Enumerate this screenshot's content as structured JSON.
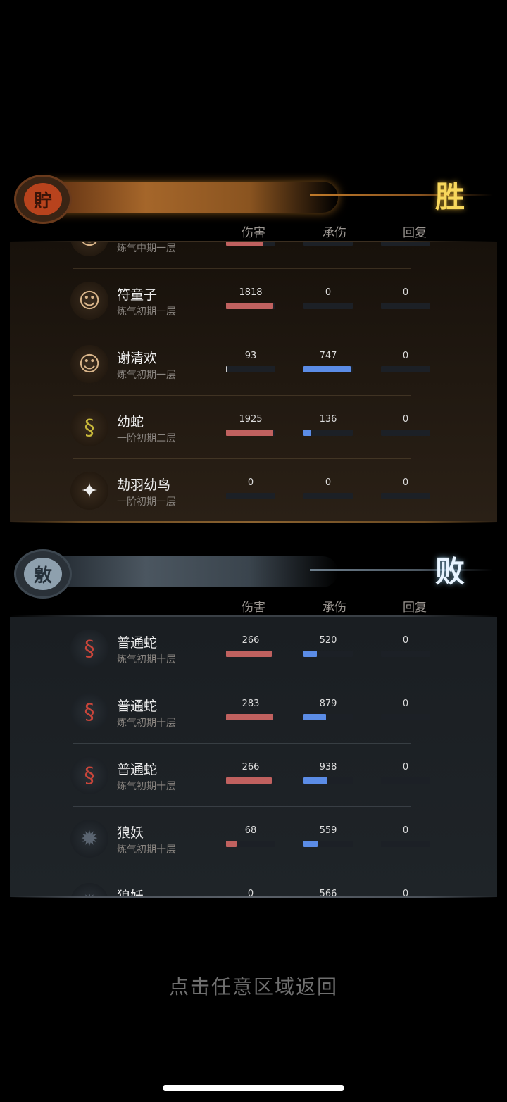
{
  "columns": {
    "damage": "伤害",
    "taken": "承伤",
    "heal": "回复"
  },
  "victory": {
    "seal_char": "貯",
    "result": "胜",
    "colors": {
      "accent": "#d88a2a",
      "seal_bg": "#b8431d",
      "seal_ring": "#6a3a1c",
      "result": "#f7d75c"
    },
    "rows": [
      {
        "name": "",
        "rank": "炼气中期一层",
        "icon": "human-icon",
        "glyph": "☺",
        "damage": "",
        "damage_pct": 0.75,
        "taken": "",
        "taken_pct": 0,
        "heal": "",
        "heal_pct": 0
      },
      {
        "name": "符童子",
        "rank": "炼气初期一层",
        "icon": "boy-icon",
        "glyph": "☺",
        "damage": "1818",
        "damage_pct": 0.94,
        "taken": "0",
        "taken_pct": 0,
        "heal": "0",
        "heal_pct": 0
      },
      {
        "name": "谢清欢",
        "rank": "炼气初期一层",
        "icon": "girl-icon",
        "glyph": "☺",
        "damage": "93",
        "damage_pct": 0.02,
        "taken": "747",
        "taken_pct": 0.95,
        "heal": "0",
        "heal_pct": 0
      },
      {
        "name": "幼蛇",
        "rank": "一阶初期二层",
        "icon": "snake-icon",
        "glyph": "§",
        "damage": "1925",
        "damage_pct": 0.95,
        "taken": "136",
        "taken_pct": 0.15,
        "heal": "0",
        "heal_pct": 0
      },
      {
        "name": "劫羽幼鸟",
        "rank": "一阶初期一层",
        "icon": "bird-icon",
        "glyph": "✦",
        "damage": "0",
        "damage_pct": 0,
        "taken": "0",
        "taken_pct": 0,
        "heal": "0",
        "heal_pct": 0
      }
    ]
  },
  "defeat": {
    "seal_char": "敫",
    "result": "败",
    "colors": {
      "accent": "#6e7f8d",
      "seal_bg": "#8ea0ae",
      "seal_ring": "#3d4750",
      "result": "#e8f4ff"
    },
    "rows": [
      {
        "name": "普通蛇",
        "rank": "炼气初期十层",
        "icon": "red-snake-icon",
        "glyph": "§",
        "damage": "266",
        "damage_pct": 0.93,
        "taken": "520",
        "taken_pct": 0.27,
        "heal": "0",
        "heal_pct": 0
      },
      {
        "name": "普通蛇",
        "rank": "炼气初期十层",
        "icon": "red-snake-icon",
        "glyph": "§",
        "damage": "283",
        "damage_pct": 0.95,
        "taken": "879",
        "taken_pct": 0.46,
        "heal": "0",
        "heal_pct": 0
      },
      {
        "name": "普通蛇",
        "rank": "炼气初期十层",
        "icon": "red-snake-icon",
        "glyph": "§",
        "damage": "266",
        "damage_pct": 0.93,
        "taken": "938",
        "taken_pct": 0.49,
        "heal": "0",
        "heal_pct": 0
      },
      {
        "name": "狼妖",
        "rank": "炼气初期十层",
        "icon": "wolf-icon",
        "glyph": "✹",
        "damage": "68",
        "damage_pct": 0.22,
        "taken": "559",
        "taken_pct": 0.28,
        "heal": "0",
        "heal_pct": 0
      },
      {
        "name": "狼妖",
        "rank": "",
        "icon": "wolf-icon",
        "glyph": "✹",
        "damage": "0",
        "damage_pct": 0,
        "taken": "566",
        "taken_pct": 0.3,
        "heal": "0",
        "heal_pct": 0
      }
    ]
  },
  "bar_colors": {
    "damage": "#c0615f",
    "taken": "#5b8ce6",
    "heal": "#5fb06a"
  },
  "footer": "点击任意区域返回"
}
